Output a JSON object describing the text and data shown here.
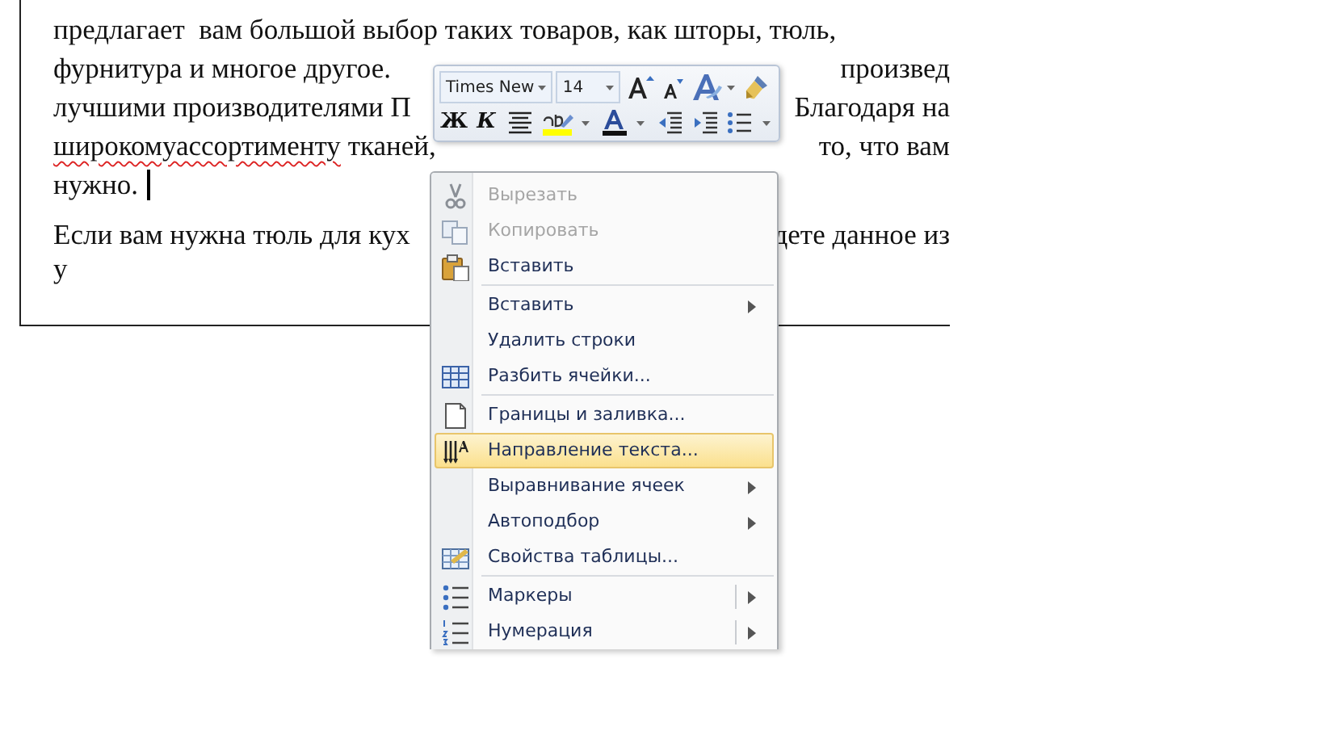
{
  "document": {
    "paragraphs": [
      {
        "lines": [
          {
            "segments": [
              {
                "text": "предлагает  вам большой выбор таких товаров, как шторы, тюль,",
                "misspelled": false
              }
            ]
          },
          {
            "segments": [
              {
                "text": "фурнитура и многое другое.",
                "misspelled": false
              }
            ],
            "right": "произвед"
          },
          {
            "segments": [
              {
                "text": "лучшими производителями П",
                "misspelled": false
              }
            ],
            "right": "Благодаря на"
          },
          {
            "segments": [
              {
                "text": "широкомуассортименту",
                "misspelled": true
              },
              {
                "text": " тканей,",
                "misspelled": false
              }
            ],
            "right": "то, что вам"
          },
          {
            "segments": [
              {
                "text": "нужно.",
                "misspelled": false
              }
            ],
            "caret": true
          }
        ]
      },
      {
        "lines": [
          {
            "segments": [
              {
                "text": "Если вам нужна тюль для кух",
                "misspelled": false
              }
            ],
            "right": "дете данное из"
          },
          {
            "segments": [
              {
                "text": "у",
                "misspelled": false
              }
            ]
          }
        ]
      }
    ]
  },
  "mini_toolbar": {
    "font": "Times New",
    "size": "14",
    "bold": "Ж",
    "italic": "К"
  },
  "context_menu": {
    "items": [
      {
        "kind": "item",
        "label": "Вырезать",
        "disabled": true,
        "selected": false,
        "submenu": false,
        "split": false
      },
      {
        "kind": "item",
        "label": "Копировать",
        "disabled": true,
        "selected": false,
        "submenu": false,
        "split": false
      },
      {
        "kind": "item",
        "label": "Вставить",
        "disabled": false,
        "selected": false,
        "submenu": false,
        "split": false
      },
      {
        "kind": "separator"
      },
      {
        "kind": "item",
        "label": "Вставить",
        "disabled": false,
        "selected": false,
        "submenu": true,
        "split": false
      },
      {
        "kind": "item",
        "label": "Удалить строки",
        "disabled": false,
        "selected": false,
        "submenu": false,
        "split": false
      },
      {
        "kind": "item",
        "label": "Разбить ячейки...",
        "disabled": false,
        "selected": false,
        "submenu": false,
        "split": false
      },
      {
        "kind": "separator"
      },
      {
        "kind": "item",
        "label": "Границы и заливка...",
        "disabled": false,
        "selected": false,
        "submenu": false,
        "split": false
      },
      {
        "kind": "item",
        "label": "Направление текста...",
        "disabled": false,
        "selected": true,
        "submenu": false,
        "split": false
      },
      {
        "kind": "item",
        "label": "Выравнивание ячеек",
        "disabled": false,
        "selected": false,
        "submenu": true,
        "split": false
      },
      {
        "kind": "item",
        "label": "Автоподбор",
        "disabled": false,
        "selected": false,
        "submenu": true,
        "split": false
      },
      {
        "kind": "item",
        "label": "Свойства таблицы...",
        "disabled": false,
        "selected": false,
        "submenu": false,
        "split": false
      },
      {
        "kind": "separator"
      },
      {
        "kind": "item",
        "label": "Маркеры",
        "disabled": false,
        "selected": false,
        "submenu": true,
        "split": true
      },
      {
        "kind": "item",
        "label": "Нумерация",
        "disabled": false,
        "selected": false,
        "submenu": true,
        "split": true
      }
    ]
  }
}
